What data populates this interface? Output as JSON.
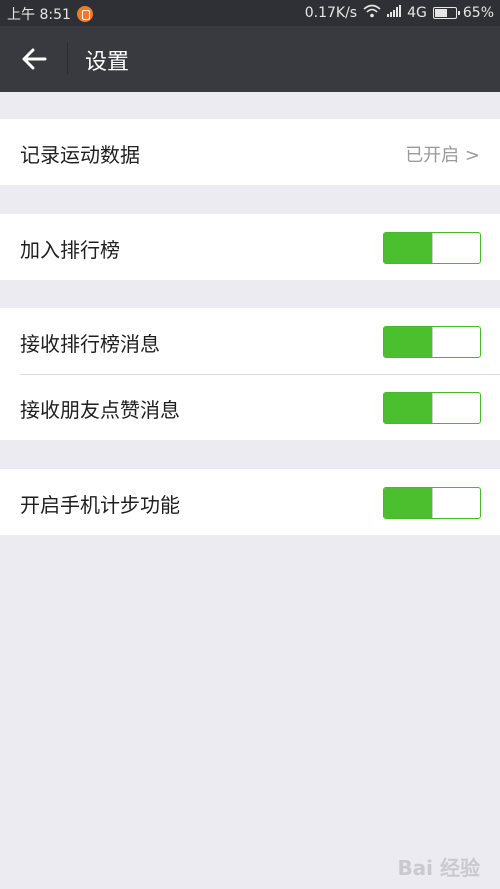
{
  "status_bar": {
    "time": "上午 8:51",
    "network_speed": "0.17K/s",
    "network_type": "4G",
    "battery_percent": "65%",
    "battery_level": 0.65
  },
  "nav": {
    "back_icon": "arrow-left-icon",
    "title": "设置"
  },
  "settings": {
    "record_data": {
      "label": "记录运动数据",
      "value": "已开启 >"
    },
    "join_ranking": {
      "label": "加入排行榜",
      "on": true
    },
    "receive_ranking_msg": {
      "label": "接收排行榜消息",
      "on": true
    },
    "receive_like_msg": {
      "label": "接收朋友点赞消息",
      "on": true
    },
    "enable_pedometer": {
      "label": "开启手机计步功能",
      "on": true
    }
  },
  "colors": {
    "toggle_on": "#4cbf2f",
    "nav_bg": "#393a3f",
    "page_bg": "#ebebf1"
  },
  "watermark": {
    "text": "Bai 经验"
  }
}
